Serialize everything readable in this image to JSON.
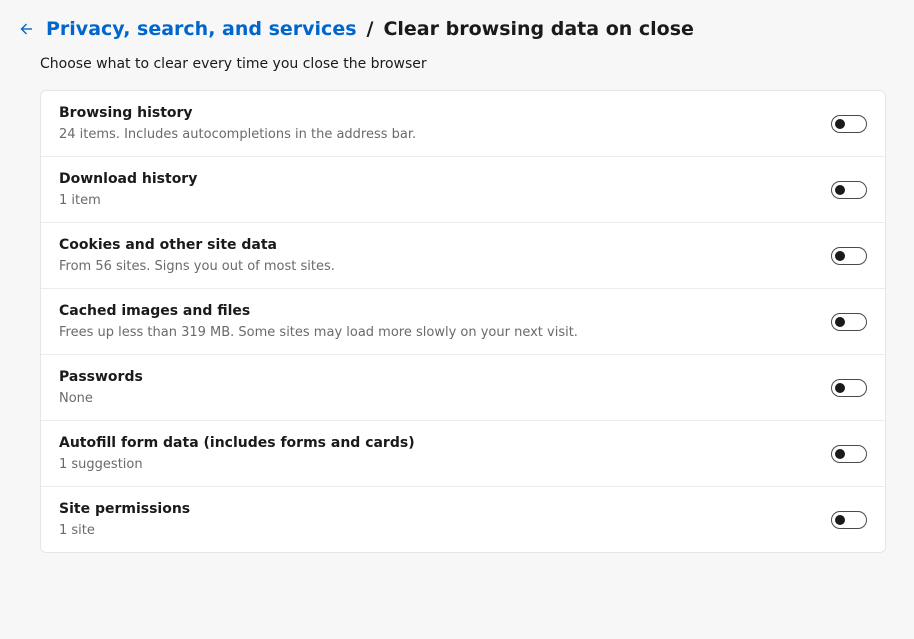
{
  "breadcrumb": {
    "parent": "Privacy, search, and services",
    "separator": "/",
    "current": "Clear browsing data on close"
  },
  "subtitle": "Choose what to clear every time you close the browser",
  "items": [
    {
      "title": "Browsing history",
      "desc": "24 items. Includes autocompletions in the address bar."
    },
    {
      "title": "Download history",
      "desc": "1 item"
    },
    {
      "title": "Cookies and other site data",
      "desc": "From 56 sites. Signs you out of most sites."
    },
    {
      "title": "Cached images and files",
      "desc": "Frees up less than 319 MB. Some sites may load more slowly on your next visit."
    },
    {
      "title": "Passwords",
      "desc": "None"
    },
    {
      "title": "Autofill form data (includes forms and cards)",
      "desc": "1 suggestion"
    },
    {
      "title": "Site permissions",
      "desc": "1 site"
    }
  ]
}
